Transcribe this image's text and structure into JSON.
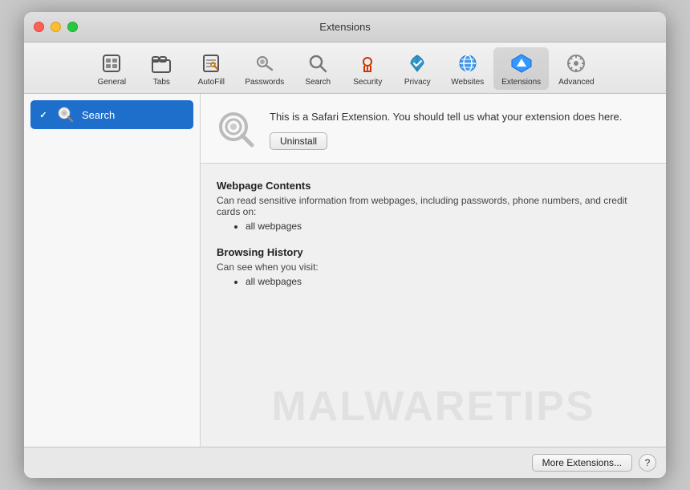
{
  "window": {
    "title": "Extensions"
  },
  "toolbar": {
    "items": [
      {
        "id": "general",
        "label": "General",
        "icon": "⬜"
      },
      {
        "id": "tabs",
        "label": "Tabs",
        "icon": "📋"
      },
      {
        "id": "autofill",
        "label": "AutoFill",
        "icon": "✏️"
      },
      {
        "id": "passwords",
        "label": "Passwords",
        "icon": "🔑"
      },
      {
        "id": "search",
        "label": "Search",
        "icon": "🔍"
      },
      {
        "id": "security",
        "label": "Security",
        "icon": "🔐"
      },
      {
        "id": "privacy",
        "label": "Privacy",
        "icon": "✋"
      },
      {
        "id": "websites",
        "label": "Websites",
        "icon": "🌐"
      },
      {
        "id": "extensions",
        "label": "Extensions",
        "icon": "⚡"
      },
      {
        "id": "advanced",
        "label": "Advanced",
        "icon": "⚙️"
      }
    ]
  },
  "sidebar": {
    "items": [
      {
        "id": "search-extension",
        "label": "Search",
        "checked": true,
        "selected": true
      }
    ]
  },
  "detail": {
    "description": "This is a Safari Extension. You should tell us what your extension does here.",
    "uninstall_label": "Uninstall",
    "permissions": [
      {
        "title": "Webpage Contents",
        "desc": "Can read sensitive information from webpages, including passwords, phone numbers, and credit cards on:",
        "items": [
          "all webpages"
        ]
      },
      {
        "title": "Browsing History",
        "desc": "Can see when you visit:",
        "items": [
          "all webpages"
        ]
      }
    ]
  },
  "footer": {
    "more_extensions_label": "More Extensions...",
    "help_label": "?"
  },
  "watermark": {
    "text": "MALWARETIPS"
  }
}
